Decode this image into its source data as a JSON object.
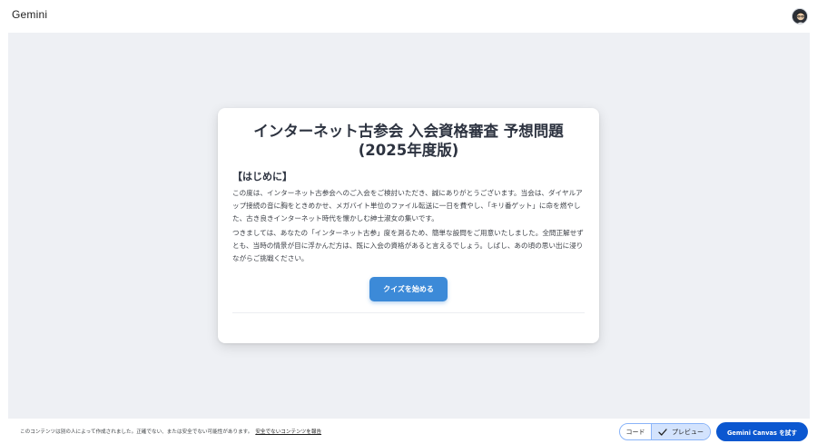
{
  "app": {
    "title": "Gemini"
  },
  "card": {
    "title": "インターネット古参会 入会資格審査 予想問題 (2025年度版)",
    "section_heading": "【はじめに】",
    "paragraph_1": "この度は、インターネット古参会へのご入会をご検討いただき、誠にありがとうございます。当会は、ダイヤルアップ接続の音に胸をときめかせ、メガバイト単位のファイル転送に一日を費やし、「キリ番ゲット」に命を燃やした、古き良きインターネット時代を懐かしむ紳士淑女の集いです。",
    "paragraph_2": "つきましては、あなたの「インターネット古参」度を測るため、簡単な設問をご用意いたしました。全問正解せずとも、当時の情景が目に浮かんだ方は、既に入会の資格があると言えるでしょう。しばし、あの頃の思い出に浸りながらご挑戦ください。",
    "start_button_label": "クイズを始める"
  },
  "footer": {
    "notice": "このコンテンツは別の人によって作成されました。正確でない、または安全でない可能性があります。",
    "report_link": "安全でないコンテンツを報告",
    "toggle": {
      "code_label": "コード",
      "preview_label": "プレビュー",
      "selected": "preview"
    },
    "try_canvas_label": "Gemini Canvas を試す"
  },
  "colors": {
    "accent": "#0b57d0",
    "start_button": "#3c8ad8",
    "stage_background": "#eef0f4",
    "toggle_selected": "#d3e3fd"
  },
  "icons": {
    "avatar": "user-avatar-icon",
    "check": "check-icon"
  }
}
